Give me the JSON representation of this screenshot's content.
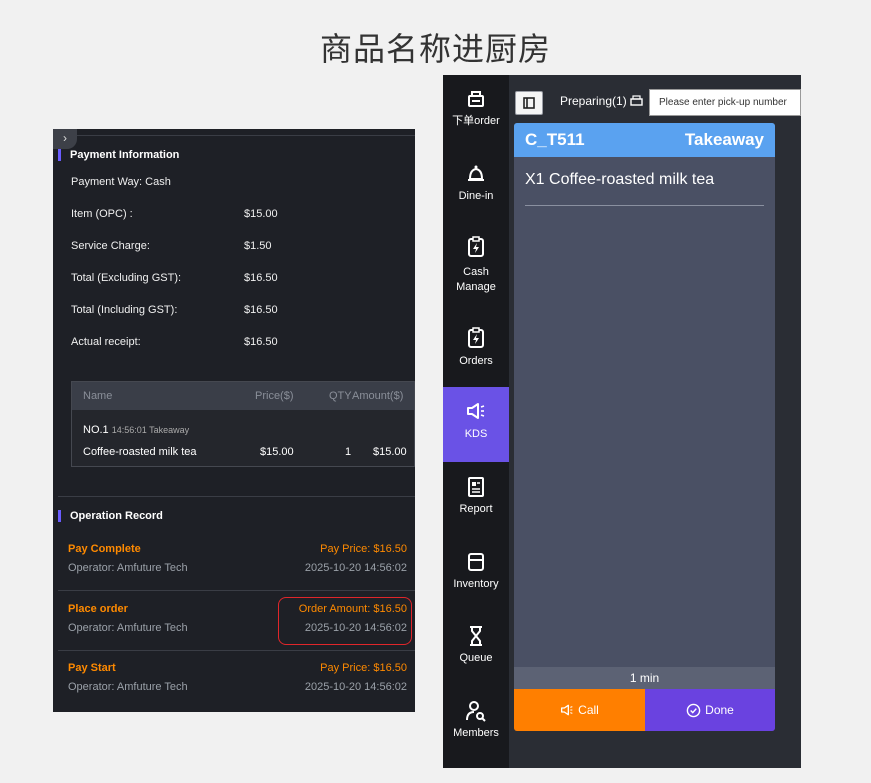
{
  "page_title": "商品名称进厨房",
  "left": {
    "collapse_icon": "›",
    "payment_heading": "Payment Information",
    "payment_way": "Payment Way: Cash",
    "rows": [
      {
        "label": "Item (OPC) :",
        "value": "$15.00"
      },
      {
        "label": "Service Charge:",
        "value": "$1.50"
      },
      {
        "label": "Total (Excluding GST):",
        "value": "$16.50"
      },
      {
        "label": "Total (Including GST):",
        "value": "$16.50"
      },
      {
        "label": "Actual receipt:",
        "value": "$16.50"
      }
    ],
    "items_table": {
      "headers": [
        "Name",
        "Price($)",
        "QTY",
        "Amount($)"
      ],
      "order_no": "NO.1",
      "order_meta": "14:56:01 Takeaway",
      "item": {
        "name": "Coffee-roasted milk tea",
        "price": "$15.00",
        "qty": "1",
        "amount": "$15.00"
      }
    },
    "operation_heading": "Operation Record",
    "operations": [
      {
        "title": "Pay Complete",
        "price": "Pay Price: $16.50",
        "operator": "Operator: Amfuture Tech",
        "date": "2025-10-20 14:56:02"
      },
      {
        "title": "Place order",
        "price": "Order Amount: $16.50",
        "operator": "Operator: Amfuture Tech",
        "date": "2025-10-20 14:56:02"
      },
      {
        "title": "Pay Start",
        "price": "Pay Price: $16.50",
        "operator": "Operator: Amfuture Tech",
        "date": "2025-10-20 14:56:02"
      }
    ]
  },
  "sidebar": {
    "items": [
      {
        "label": "下单order",
        "icon": "register-icon"
      },
      {
        "label": "Dine-in",
        "icon": "bell-icon"
      },
      {
        "label": "Cash Manage",
        "icon": "clipboard-bolt-icon"
      },
      {
        "label": "Orders",
        "icon": "clipboard-bolt-icon"
      },
      {
        "label": "KDS",
        "icon": "megaphone-icon",
        "active": true
      },
      {
        "label": "Report",
        "icon": "report-icon"
      },
      {
        "label": "Inventory",
        "icon": "box-icon"
      },
      {
        "label": "Queue",
        "icon": "hourglass-icon"
      },
      {
        "label": "Members",
        "icon": "member-icon"
      }
    ]
  },
  "kds": {
    "preparing_label": "Preparing(1)",
    "search_placeholder": "Please enter pick-up number",
    "ticket": {
      "code": "C_T511",
      "type": "Takeaway",
      "item": "X1 Coffee-roasted milk tea",
      "elapsed": "1 min",
      "call_label": "Call",
      "done_label": "Done"
    },
    "colors": {
      "accent": "#6a52e6",
      "ticket_header": "#5aa2f0",
      "call": "#ff7f00",
      "done": "#6a42e0"
    }
  }
}
